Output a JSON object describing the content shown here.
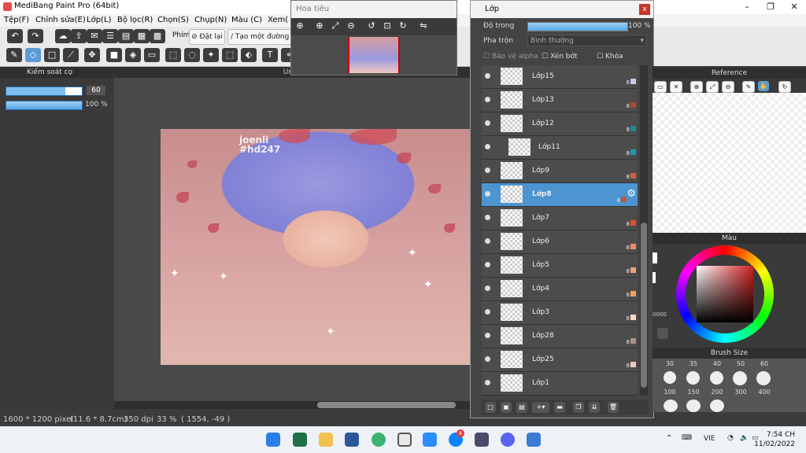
{
  "window": {
    "title": "MediBang Paint Pro (64bit)",
    "controls": [
      "–",
      "❐",
      "✕"
    ]
  },
  "menu": [
    "Tệp(F)",
    "Chỉnh sửa(E)",
    "Lớp(L)",
    "Bộ lọc(R)",
    "Chọn(S)",
    "Chụp(N)",
    "Màu (C)",
    "Xem("
  ],
  "toolbar": {
    "pen_label": "Phím",
    "reset_label": "Đặt lại",
    "line_label": "Tạo một đường th"
  },
  "brush_control": {
    "title": "Kiểm soát cọ",
    "size_value": "60",
    "opacity_value": "100 %"
  },
  "canvas": {
    "tab_title": "Untitled",
    "signature_line1": "joenli",
    "signature_line2": "#hd247"
  },
  "status": {
    "dimensions": "1600 * 1200 pixel",
    "physical": "(11.6 * 8.7cm)",
    "dpi": "350 dpi",
    "zoom": "33 %",
    "coords": "( 1554, -49 )"
  },
  "navigator": {
    "title": "Hoa tiêu"
  },
  "layers": {
    "title": "Lớp",
    "opacity_label": "Độ trong",
    "opacity_value": "100 %",
    "opacity_fraction": 1.0,
    "blend_label": "Pha trộn",
    "blend_value": "Bình thường",
    "protect_alpha_label": "Bảo vệ alpha",
    "clip_label": "Xén bớt",
    "lock_label": "Khóa",
    "items": [
      {
        "name": "Lớp15",
        "num": "8",
        "color": "#c8c8f0",
        "selected": false
      },
      {
        "name": "Lớp13",
        "num": "8",
        "color": "#b04a2a",
        "selected": false
      },
      {
        "name": "Lớp12",
        "num": "8",
        "color": "#1a8a9a",
        "selected": false
      },
      {
        "name": "Lớp11",
        "num": "8",
        "color": "#1a9ab0",
        "selected": false,
        "indent": true
      },
      {
        "name": "Lớp9",
        "num": "8",
        "color": "#d0603a",
        "selected": false
      },
      {
        "name": "Lớp8",
        "num": "8",
        "color": "#b85a3a",
        "selected": true
      },
      {
        "name": "Lớp7",
        "num": "8",
        "color": "#e0502a",
        "selected": false
      },
      {
        "name": "Lớp6",
        "num": "8",
        "color": "#f08a6a",
        "selected": false
      },
      {
        "name": "Lớp5",
        "num": "8",
        "color": "#f0a080",
        "selected": false
      },
      {
        "name": "Lớp4",
        "num": "8",
        "color": "#f0a060",
        "selected": false
      },
      {
        "name": "Lớp3",
        "num": "8",
        "color": "#f8d8c0",
        "selected": false
      },
      {
        "name": "Lớp28",
        "num": "8",
        "color": "#b09088",
        "selected": false
      },
      {
        "name": "Lớp25",
        "num": "8",
        "color": "#f0c8c0",
        "selected": false
      },
      {
        "name": "Lớp1",
        "num": "",
        "color": "",
        "selected": false
      }
    ]
  },
  "reference": {
    "title": "Reference"
  },
  "color_panel": {
    "title": "Màu",
    "hex_partial": "0000"
  },
  "brush_size": {
    "title": "Brush Size",
    "row1": [
      "30",
      "35",
      "40",
      "50",
      "60"
    ],
    "row2": [
      "100",
      "150",
      "200",
      "300",
      "400"
    ]
  },
  "taskbar": {
    "lang": "VIE",
    "time": "7:54 CH",
    "date": "11/02/2022",
    "badge": "4"
  }
}
